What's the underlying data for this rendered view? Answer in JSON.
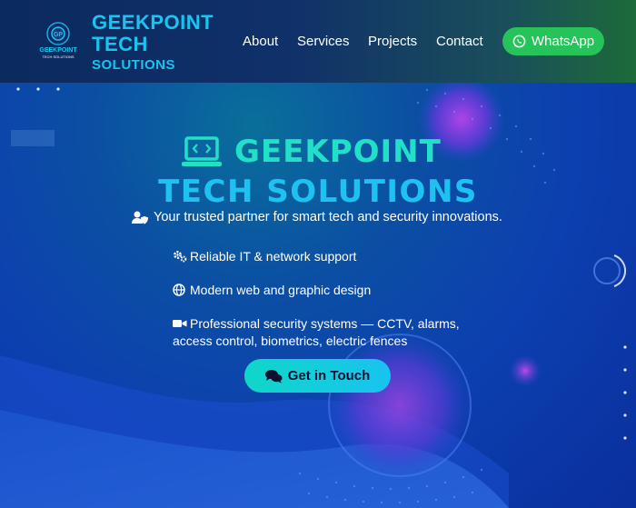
{
  "header": {
    "brand_line1": "GEEKPOINT",
    "brand_line2": "TECH",
    "brand_line3": "SOLUTIONS",
    "logo_text_top": "GEEKPOINT",
    "logo_text_bottom": "TECH SOLUTIONS",
    "nav": [
      {
        "label": "About"
      },
      {
        "label": "Services"
      },
      {
        "label": "Projects"
      },
      {
        "label": "Contact"
      }
    ],
    "whatsapp_label": "WhatsApp"
  },
  "hero": {
    "title_line1": "GEEKPOINT",
    "title_line2": "TECH SOLUTIONS",
    "tagline": "Your trusted partner for smart tech and security innovations.",
    "features": [
      {
        "icon": "cogs-icon",
        "text": "Reliable IT & network support"
      },
      {
        "icon": "globe-icon",
        "text": "Modern web and graphic design"
      },
      {
        "icon": "video-camera-icon",
        "text_line1": "Professional security systems — CCTV, alarms,",
        "text_line2": "access control, biometrics, electric fences"
      }
    ],
    "cta_label": "Get in Touch"
  },
  "colors": {
    "accent_teal": "#22e0c8",
    "accent_cyan": "#19c4ef",
    "whatsapp_green": "#25c35a",
    "header_navy": "#0b2a5e"
  }
}
